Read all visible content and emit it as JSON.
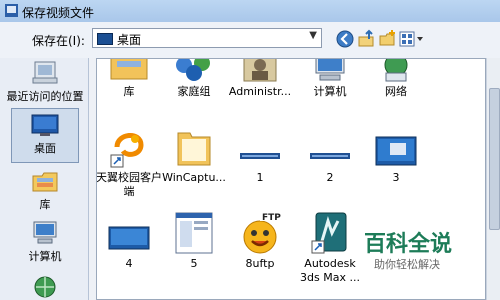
{
  "window": {
    "title": "保存视频文件"
  },
  "toolbar": {
    "save_in_label": "保存在(I):",
    "location": "桌面",
    "buttons": [
      {
        "name": "back-button",
        "icon": "back-arrow-icon"
      },
      {
        "name": "up-folder-button",
        "icon": "up-folder-icon"
      },
      {
        "name": "new-folder-button",
        "icon": "new-folder-icon"
      },
      {
        "name": "view-menu-button",
        "icon": "view-grid-icon"
      }
    ]
  },
  "sidebar": {
    "items": [
      {
        "label": "最近访问的位置",
        "icon": "recent-places-icon",
        "selected": false
      },
      {
        "label": "桌面",
        "icon": "desktop-icon",
        "selected": true
      },
      {
        "label": "库",
        "icon": "library-icon",
        "selected": false
      },
      {
        "label": "计算机",
        "icon": "computer-icon",
        "selected": false
      },
      {
        "label": "",
        "icon": "network-icon",
        "selected": false
      }
    ]
  },
  "files": [
    {
      "label": "库",
      "icon": "library-folder-icon"
    },
    {
      "label": "家庭组",
      "icon": "homegroup-icon"
    },
    {
      "label": "Administr...",
      "icon": "user-folder-icon"
    },
    {
      "label": "计算机",
      "icon": "computer-icon"
    },
    {
      "label": "网络",
      "icon": "network-icon"
    },
    {
      "label": "天翼校园客户端",
      "icon": "tianyi-app-icon"
    },
    {
      "label": "WinCaptu...",
      "icon": "folder-icon"
    },
    {
      "label": "1",
      "icon": "video-thumbnail-icon"
    },
    {
      "label": "2",
      "icon": "video-thumbnail-icon"
    },
    {
      "label": "3",
      "icon": "desktop-screenshot-icon"
    },
    {
      "label": "4",
      "icon": "video-thumbnail-icon"
    },
    {
      "label": "5",
      "icon": "document-thumbnail-icon"
    },
    {
      "label": "8uftp",
      "icon": "ftp-smiley-icon"
    },
    {
      "label": "Autodesk 3ds Max ...",
      "icon": "3dsmax-icon"
    }
  ],
  "watermark": {
    "title": "百科全说",
    "subtitle": "助你轻松解决"
  },
  "colors": {
    "title_bar": "#b7d2f0",
    "selection": "#cfdcec",
    "watermark": "#1d7c58"
  }
}
